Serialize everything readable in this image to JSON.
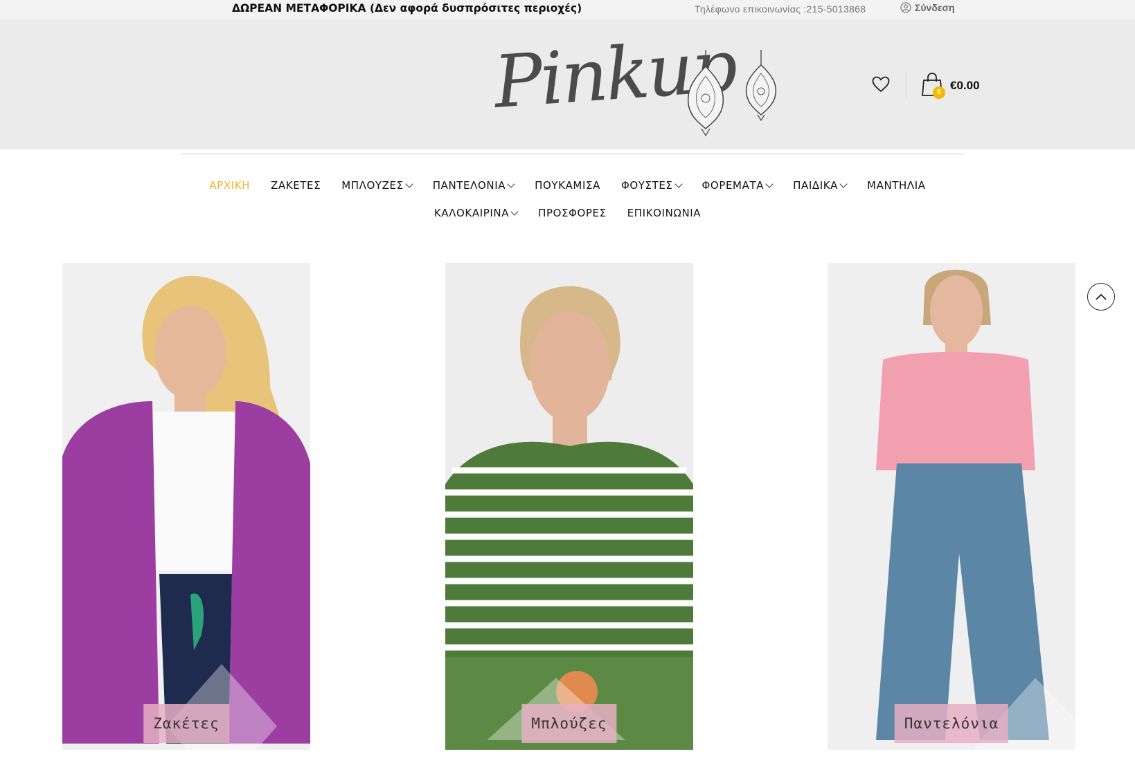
{
  "topbar": {
    "promo": "ΔΩΡΕΑΝ ΜΕΤΑΦΟΡΙΚΑ (Δεν αφορά δυσπρόσιτες περιοχές)",
    "phone": "Τηλέφωνο επικοινωνίας :215-5013868",
    "login_label": "Σύνδεση",
    "login_icon": "user-icon"
  },
  "header": {
    "logo_text": "Pinkup",
    "wishlist_icon": "heart-icon",
    "cart_icon": "shopping-bag-icon",
    "cart_count": "0",
    "cart_total": "€0.00"
  },
  "nav": {
    "row1": [
      {
        "label": "ΑΡΧΙΚΗ",
        "active": true,
        "dropdown": false
      },
      {
        "label": "ΖΑΚΕΤΕΣ",
        "active": false,
        "dropdown": false
      },
      {
        "label": "ΜΠΛΟΥΖΕΣ",
        "active": false,
        "dropdown": true
      },
      {
        "label": "ΠΑΝΤΕΛΟΝΙΑ",
        "active": false,
        "dropdown": true
      },
      {
        "label": "ΠΟΥΚΑΜΙΣΑ",
        "active": false,
        "dropdown": false
      },
      {
        "label": "ΦΟΥΣΤΕΣ",
        "active": false,
        "dropdown": true
      },
      {
        "label": "ΦΟΡΕΜΑΤΑ",
        "active": false,
        "dropdown": true
      },
      {
        "label": "ΠΑΙΔΙΚΑ",
        "active": false,
        "dropdown": true
      },
      {
        "label": "ΜΑΝΤΗΛΙΑ",
        "active": false,
        "dropdown": false
      }
    ],
    "row2": [
      {
        "label": "ΚΑΛΟΚΑΙΡΙΝΑ",
        "active": false,
        "dropdown": true
      },
      {
        "label": "ΠΡΟΣΦΟΡΕΣ",
        "active": false,
        "dropdown": false
      },
      {
        "label": "ΕΠΙΚΟΙΝΩΝΙΑ",
        "active": false,
        "dropdown": false
      }
    ]
  },
  "categories": [
    {
      "label": "Ζακέτες"
    },
    {
      "label": "Μπλούζες"
    },
    {
      "label": "Παντελόνια"
    }
  ],
  "colors": {
    "accent": "#f0b429",
    "label_bg": "#e6afc3",
    "header_bg": "#ebebeb"
  },
  "scroll_top_icon": "chevron-up-icon"
}
